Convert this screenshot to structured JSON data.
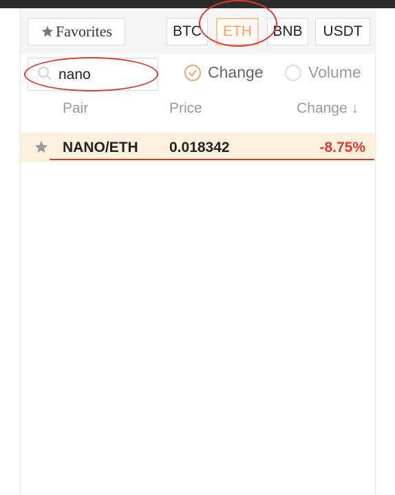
{
  "favorites": {
    "label": "Favorites",
    "icon": "star-icon"
  },
  "market_tabs": [
    {
      "label": "BTC",
      "active": false
    },
    {
      "label": "ETH",
      "active": true
    },
    {
      "label": "BNB",
      "active": false
    },
    {
      "label": "USDT",
      "active": false
    }
  ],
  "search": {
    "value": "nano",
    "icon": "search-icon"
  },
  "sort_options": [
    {
      "label": "Change",
      "selected": true
    },
    {
      "label": "Volume",
      "selected": false
    }
  ],
  "table": {
    "headers": {
      "pair": "Pair",
      "price": "Price",
      "change": "Change ↓"
    },
    "rows": [
      {
        "pair": "NANO/ETH",
        "price": "0.018342",
        "change": "-8.75%"
      }
    ]
  },
  "colors": {
    "accent": "#f4a261",
    "negative": "#d93a33",
    "row_highlight": "#fdf1dd",
    "annotation": "#d93a33"
  }
}
